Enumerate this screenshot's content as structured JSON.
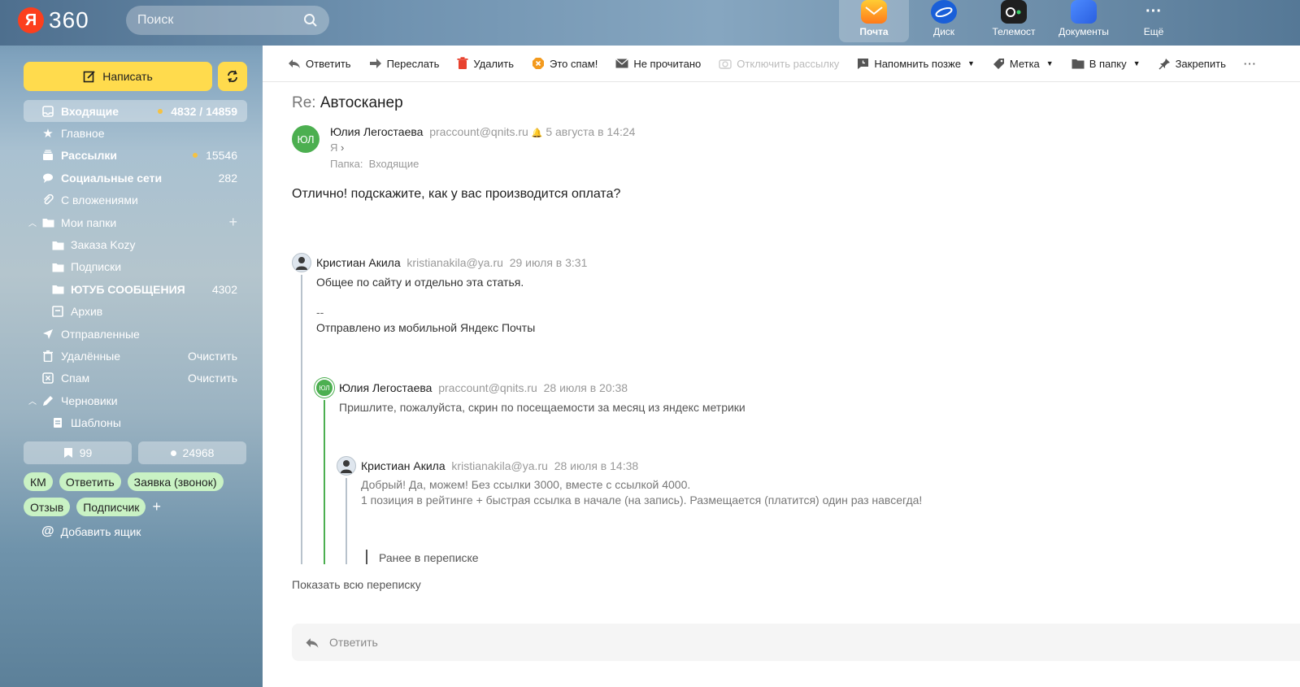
{
  "header": {
    "logo_letter": "Я",
    "logo_text": "360",
    "search_placeholder": "Поиск",
    "apps": [
      {
        "label": "Почта",
        "icon": "mail-icon",
        "active": true
      },
      {
        "label": "Диск",
        "icon": "disk-icon",
        "active": false
      },
      {
        "label": "Телемост",
        "icon": "telemost-icon",
        "active": false
      },
      {
        "label": "Документы",
        "icon": "documents-icon",
        "active": false
      },
      {
        "label": "Ещё",
        "icon": "more-icon",
        "active": false
      }
    ]
  },
  "sidebar": {
    "compose_label": "Написать",
    "folders": {
      "inbox": {
        "name": "Входящие",
        "count": "4832 / 14859"
      },
      "main": {
        "name": "Главное"
      },
      "newsletters": {
        "name": "Рассылки",
        "count": "15546"
      },
      "social": {
        "name": "Социальные сети",
        "count": "282"
      },
      "attachments": {
        "name": "С вложениями"
      },
      "my_folders": {
        "name": "Мои папки"
      },
      "kozy": {
        "name": "Заказа Kozy"
      },
      "subscriptions": {
        "name": "Подписки"
      },
      "youtube": {
        "name": "ЮТУБ СООБЩЕНИЯ",
        "count": "4302"
      },
      "archive": {
        "name": "Архив"
      },
      "sent": {
        "name": "Отправленные"
      },
      "deleted": {
        "name": "Удалённые",
        "action": "Очистить"
      },
      "spam": {
        "name": "Спам",
        "action": "Очистить"
      },
      "drafts": {
        "name": "Черновики"
      },
      "templates": {
        "name": "Шаблоны"
      }
    },
    "bookmarked_count": "99",
    "unread_count": "24968",
    "labels_row1": [
      "КМ",
      "Ответить",
      "Заявка (звонок)"
    ],
    "labels_row2": [
      "Отзыв",
      "Подписчик"
    ],
    "add_mailbox": "Добавить ящик"
  },
  "toolbar": {
    "reply": "Ответить",
    "forward": "Переслать",
    "delete": "Удалить",
    "spam": "Это спам!",
    "unread": "Не прочитано",
    "unsubscribe": "Отключить рассылку",
    "remind": "Напомнить позже",
    "label": "Метка",
    "move": "В папку",
    "pin": "Закрепить"
  },
  "message": {
    "subject_prefix": "Re:",
    "subject": "Автосканер",
    "avatar_initials": "ЮЛ",
    "sender_name": "Юлия Легостаева",
    "sender_email": "praccount@qnits.ru",
    "date": "5 августа в 14:24",
    "to": "Я",
    "folder_label": "Папка:",
    "folder": "Входящие",
    "body": "Отлично! подскажите, как у вас производится оплата?"
  },
  "quotes": [
    {
      "name": "Кристиан Акила",
      "email": "kristianakila@ya.ru",
      "date": "29 июля в 3:31",
      "lines": [
        "Общее по сайту и отдельно эта статья.",
        "--",
        "Отправлено из мобильной Яндекс Почты"
      ]
    },
    {
      "name": "Юлия Легостаева",
      "initials": "ЮЛ",
      "email": "praccount@qnits.ru",
      "date": "28 июля в 20:38",
      "lines": [
        "Пришлите, пожалуйста, скрин по посещаемости за месяц из яндекс метрики"
      ]
    },
    {
      "name": "Кристиан Акила",
      "email": "kristianakila@ya.ru",
      "date": "28 июля в 14:38",
      "lines": [
        "Добрый! Да, можем! Без ссылки 3000, вместе с ссылкой 4000.",
        "1 позиция в рейтинге + быстрая ссылка в начале (на запись). Размещается (платится) один раз навсегда!"
      ]
    }
  ],
  "earlier_label": "Ранее в переписке",
  "show_all": "Показать всю переписку",
  "reply_box_label": "Ответить"
}
